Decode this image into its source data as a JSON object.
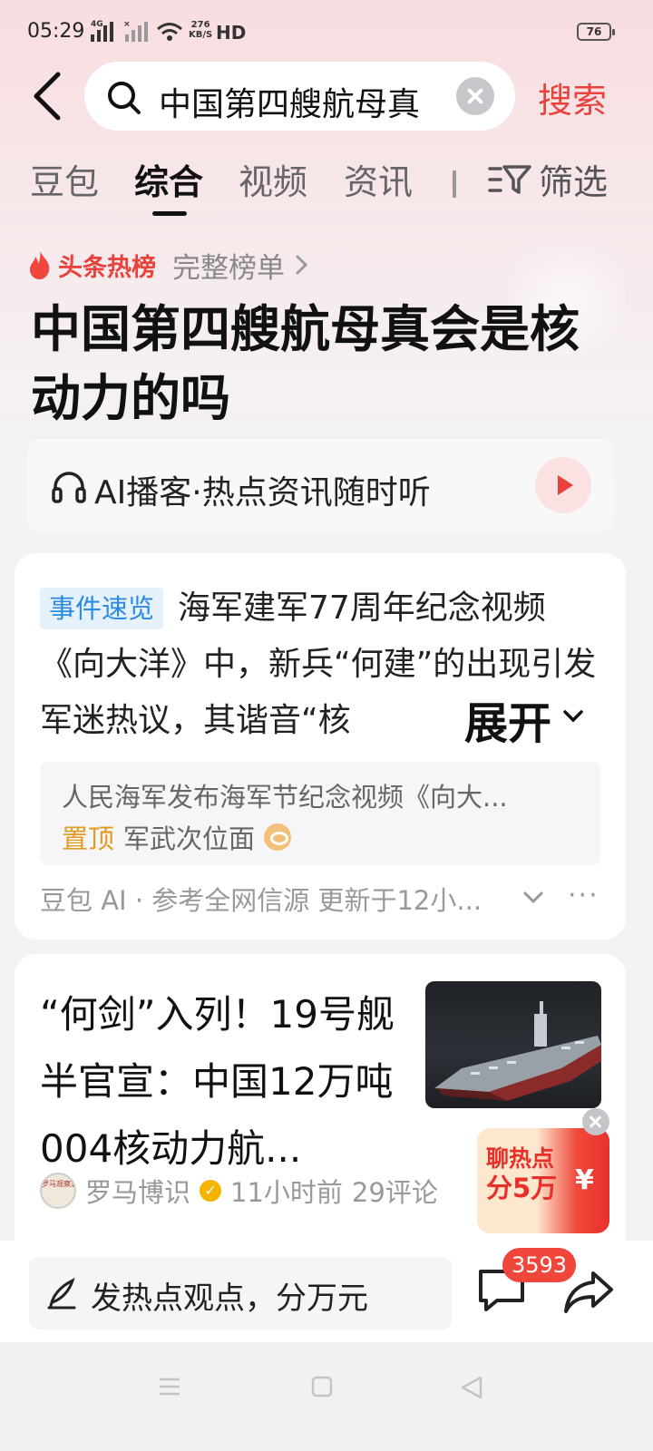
{
  "status_bar": {
    "time": "05:29",
    "network_1": "4G",
    "network_2": "×",
    "speed_value": "276",
    "speed_unit": "KB/S",
    "hd": "HD",
    "battery": "76"
  },
  "search": {
    "query": "中国第四艘航母真",
    "button_label": "搜索"
  },
  "tabs": {
    "items": [
      "豆包",
      "综合",
      "视频",
      "资讯"
    ],
    "active_index": 1,
    "filter_label": "筛选"
  },
  "hot_board": {
    "label": "头条热榜",
    "full_list_label": "完整榜单",
    "headline": "中国第四艘航母真会是核动力的吗"
  },
  "podcast": {
    "label": "AI播客·热点资讯随时听"
  },
  "event_card": {
    "badge": "事件速览",
    "text": "海军建军77周年纪念视频《向大洋》中，新兵“何建”的出现引发军迷热议，其谐音“核",
    "expand_label": "展开",
    "source_title": "人民海军发布海军节纪念视频《向大...",
    "pin_label": "置顶",
    "source_name": "军武次位面",
    "footer": "豆包 AI · 参考全网信源 更新于12小..."
  },
  "article_card": {
    "title": "“何剑”入列！19号舰半官宣：中国12万吨004核动力航...",
    "author": "罗马博识",
    "avatar_text": "罗马观察志",
    "time": "11小时前",
    "comments": "29评论"
  },
  "promo": {
    "line1": "聊热点",
    "line2": "分5万",
    "yen": "¥"
  },
  "bottom_bar": {
    "comment_placeholder": "发热点观点，分万元",
    "comment_count": "3593"
  },
  "colors": {
    "accent": "#e8423c",
    "badge_blue": "#2a8be0",
    "pin_orange": "#e39a20"
  }
}
